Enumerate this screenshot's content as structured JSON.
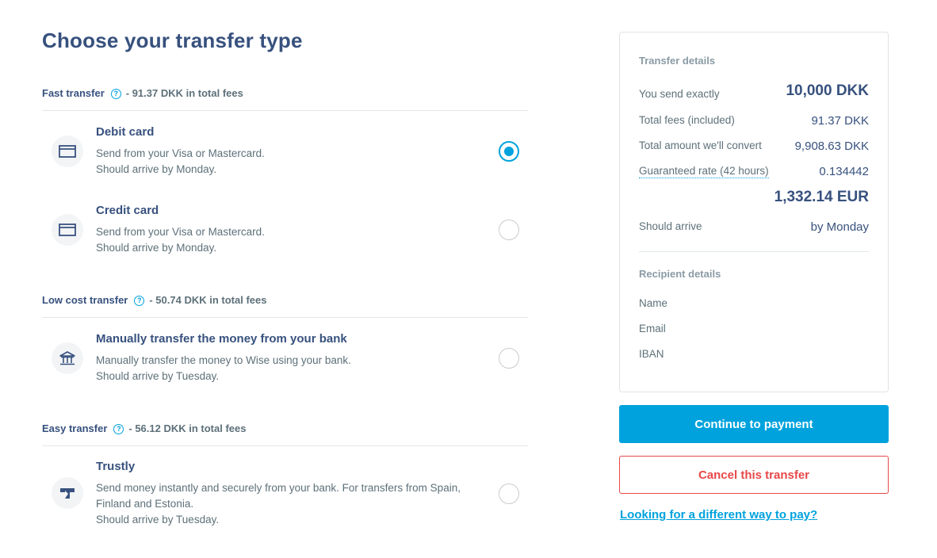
{
  "page": {
    "title": "Choose your transfer type"
  },
  "sections": [
    {
      "name": "Fast transfer",
      "fee": "- 91.37 DKK in total fees",
      "options": [
        {
          "title": "Debit card",
          "desc_line1": "Send from your Visa or Mastercard.",
          "desc_line2": "Should arrive by Monday.",
          "icon": "card-icon",
          "selected": true
        },
        {
          "title": "Credit card",
          "desc_line1": "Send from your Visa or Mastercard.",
          "desc_line2": "Should arrive by Monday.",
          "icon": "card-icon",
          "selected": false
        }
      ]
    },
    {
      "name": "Low cost transfer",
      "fee": "- 50.74 DKK in total fees",
      "options": [
        {
          "title": "Manually transfer the money from your bank",
          "desc_line1": "Manually transfer the money to Wise using your bank.",
          "desc_line2": "Should arrive by Tuesday.",
          "icon": "bank-icon",
          "selected": false
        }
      ]
    },
    {
      "name": "Easy transfer",
      "fee": "- 56.12 DKK in total fees",
      "options": [
        {
          "title": "Trustly",
          "desc_line1": "Send money instantly and securely from your bank. For transfers from Spain, Finland and Estonia.",
          "desc_line2": "Should arrive by Tuesday.",
          "icon": "trustly-icon",
          "selected": false
        }
      ]
    }
  ],
  "help_glyph": "?",
  "transfer_details": {
    "heading": "Transfer details",
    "send_label": "You send exactly",
    "send_value": "10,000 DKK",
    "fees_label": "Total fees (included)",
    "fees_value": "91.37 DKK",
    "convert_label": "Total amount we'll convert",
    "convert_value": "9,908.63 DKK",
    "rate_label": "Guaranteed rate (42 hours)",
    "rate_value": "0.134442",
    "receive_value": "1,332.14 EUR",
    "arrive_label": "Should arrive",
    "arrive_value": "by Monday"
  },
  "recipient_details": {
    "heading": "Recipient details",
    "name_label": "Name",
    "email_label": "Email",
    "iban_label": "IBAN"
  },
  "actions": {
    "continue_label": "Continue to payment",
    "cancel_label": "Cancel this transfer",
    "different_way_label": "Looking for a different way to pay?"
  },
  "colors": {
    "primary": "#00a2dd",
    "text_dark": "#37517e",
    "text_muted": "#5d7079",
    "danger": "#e74848"
  }
}
